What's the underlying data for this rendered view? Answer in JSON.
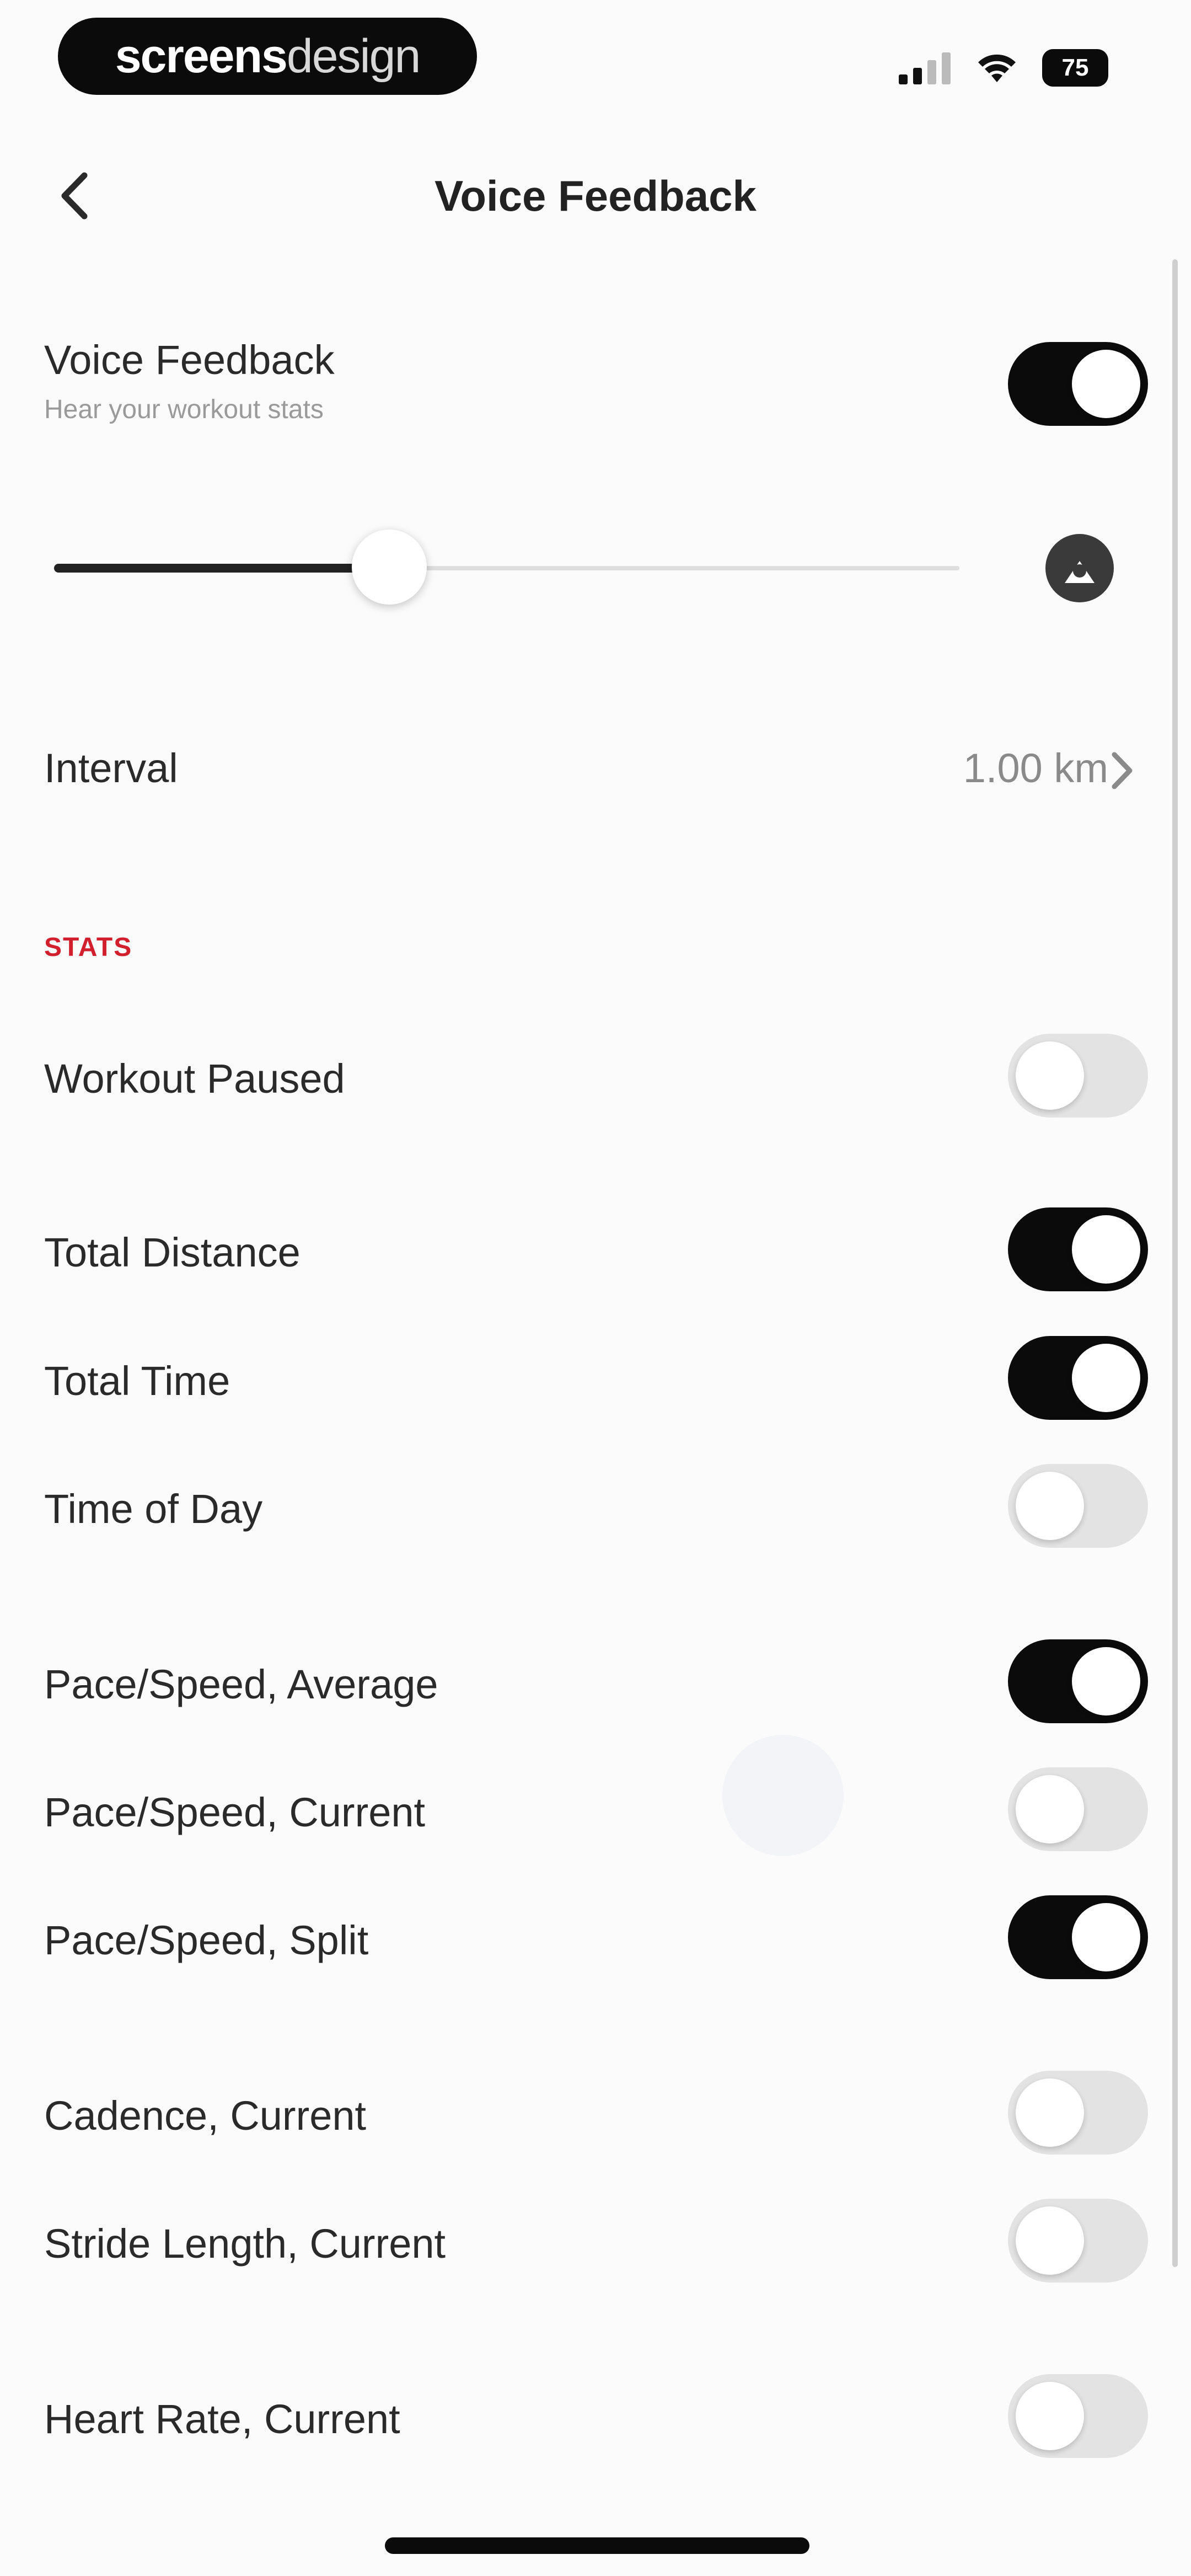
{
  "status_bar": {
    "brand_bold": "screens",
    "brand_light": "design",
    "battery": "75"
  },
  "header": {
    "title": "Voice Feedback"
  },
  "voice_feedback": {
    "label": "Voice Feedback",
    "subtitle": "Hear your workout stats",
    "enabled": true
  },
  "volume": {
    "level_fraction": 0.37
  },
  "interval": {
    "label": "Interval",
    "value": "1.00 km"
  },
  "stats": {
    "section_label": "STATS",
    "items": [
      {
        "label": "Workout Paused",
        "enabled": false
      },
      {
        "label": "Total Distance",
        "enabled": true
      },
      {
        "label": "Total Time",
        "enabled": true
      },
      {
        "label": "Time of Day",
        "enabled": false
      },
      {
        "label": "Pace/Speed, Average",
        "enabled": true
      },
      {
        "label": "Pace/Speed, Current",
        "enabled": false
      },
      {
        "label": "Pace/Speed, Split",
        "enabled": true
      },
      {
        "label": "Cadence, Current",
        "enabled": false
      },
      {
        "label": "Stride Length, Current",
        "enabled": false
      },
      {
        "label": "Heart Rate, Current",
        "enabled": false
      }
    ]
  },
  "colors": {
    "accent_red": "#d21f2d",
    "toggle_on": "#0b0b0b",
    "toggle_off": "#e3e3e3"
  }
}
